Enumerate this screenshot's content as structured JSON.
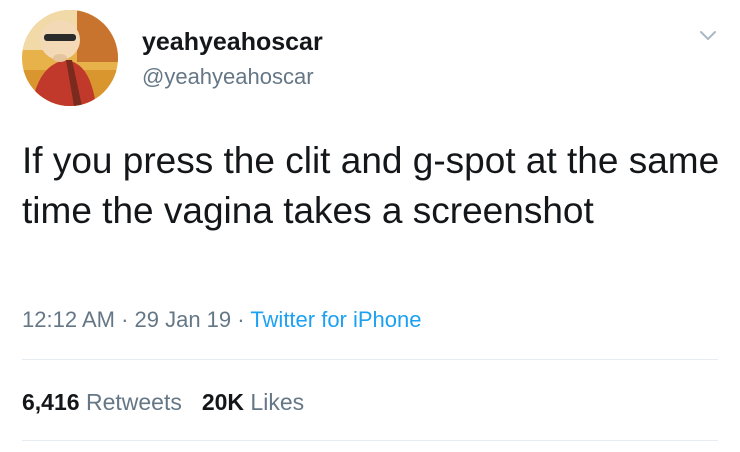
{
  "tweet": {
    "display_name": "yeahyeahoscar",
    "handle": "@yeahyeahoscar",
    "text": "If you press the clit and g-spot at the same time the vagina takes a screenshot",
    "time": "12:12 AM",
    "separator": " · ",
    "date": "29 Jan 19",
    "source": "Twitter for iPhone",
    "retweets_count": "6,416",
    "retweets_label": "Retweets",
    "likes_count": "20K",
    "likes_label": "Likes"
  },
  "icons": {
    "caret": "chevron-down-icon",
    "avatar": "avatar"
  },
  "colors": {
    "text_primary": "#14171a",
    "text_secondary": "#657786",
    "link": "#1da1f2",
    "divider": "#e6ecf0"
  }
}
